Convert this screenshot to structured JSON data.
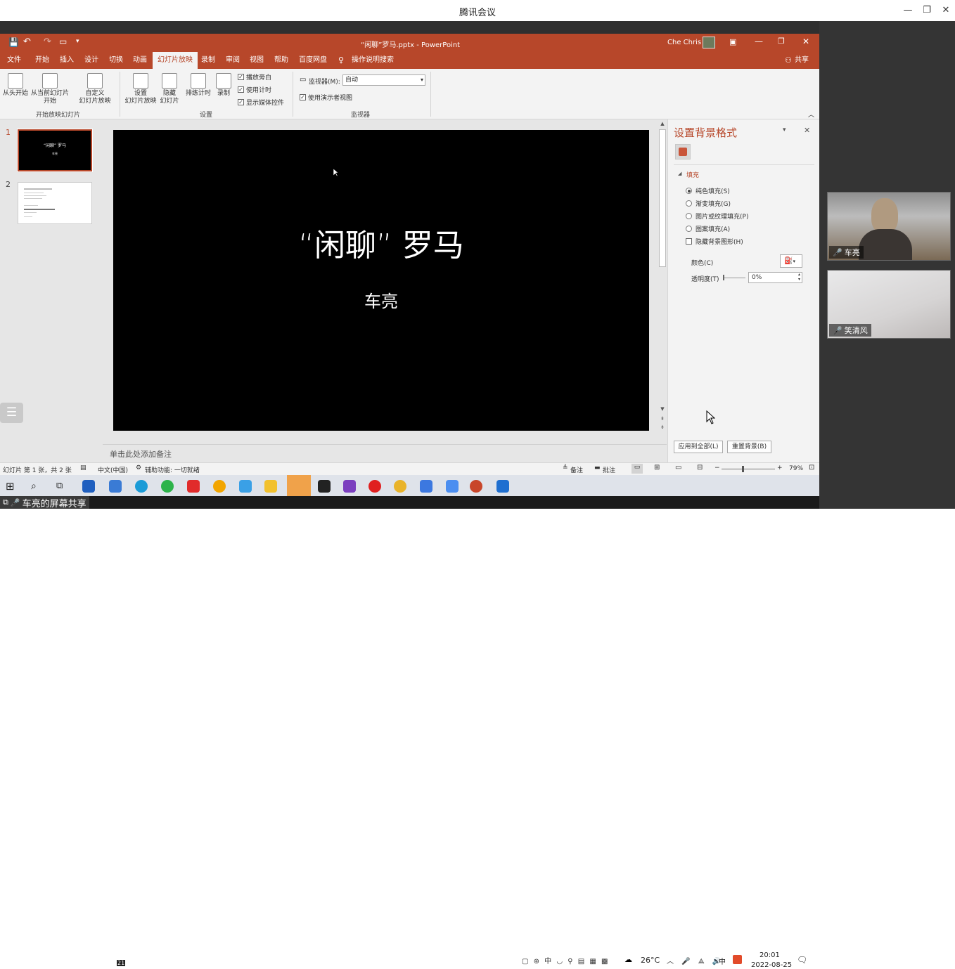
{
  "meeting": {
    "title": "腾讯会议"
  },
  "powerpoint": {
    "doc_title": "“闲聊”罗马.pptx  -  PowerPoint",
    "user": "Che Chris",
    "share": "共享",
    "tabs": [
      "文件",
      "开始",
      "插入",
      "设计",
      "切换",
      "动画",
      "幻灯片放映",
      "录制",
      "审阅",
      "视图",
      "帮助",
      "百度网盘",
      "操作说明搜索"
    ],
    "ribbon": {
      "from_start": "从头开始",
      "from_current_1": "从当前幻灯片",
      "from_current_2": "开始",
      "custom_1": "自定义",
      "custom_2": "幻灯片放映",
      "group_start": "开始放映幻灯片",
      "setup_1": "设置",
      "setup_2": "幻灯片放映",
      "hide_1": "隐藏",
      "hide_2": "幻灯片",
      "rehearse": "排练计时",
      "record": "录制",
      "chk_narration": "播放旁白",
      "chk_timing": "使用计时",
      "chk_media": "显示媒体控件",
      "group_setup": "设置",
      "monitor_label": "监视器(M):",
      "monitor_value": "自动",
      "presenter_view": "使用演示者视图",
      "group_monitor": "监视器"
    },
    "slides": {
      "thumb1_num": "1",
      "thumb2_num": "2",
      "thumb1_title": "“闲聊” 罗马",
      "thumb1_sub": "车亮",
      "title": "“闲聊” 罗马",
      "subtitle": "车亮"
    },
    "notes_placeholder": "单击此处添加备注",
    "format_pane": {
      "title": "设置背景格式",
      "section": "填充",
      "options": [
        "纯色填充(S)",
        "渐变填充(G)",
        "图片或纹理填充(P)",
        "图案填充(A)"
      ],
      "selected_option": "纯色填充(S)",
      "hide_bg": "隐藏背景图形(H)",
      "color_label": "颜色(C)",
      "transparency_label": "透明度(T)",
      "transparency_value": "0%",
      "apply_all": "应用到全部(L)",
      "reset": "重置背景(B)"
    },
    "status": {
      "slide_info": "幻灯片 第 1 张，共 2 张",
      "language": "中文(中国)",
      "accessibility": "辅助功能: 一切就绪",
      "notes": "备注",
      "comments": "批注",
      "zoom": "79%"
    }
  },
  "taskbar": {
    "temperature": "26°C",
    "ime": "中",
    "time": "20:01",
    "date": "2022-08-25",
    "mail_badge": "21"
  },
  "participants": [
    {
      "name": "车亮"
    },
    {
      "name": "笑清风"
    }
  ],
  "share_label": "车亮的屏幕共享",
  "colors": {
    "ppt_accent": "#b7472a",
    "slide_bg": "#000000",
    "taskbar": "#dfe3ea"
  }
}
